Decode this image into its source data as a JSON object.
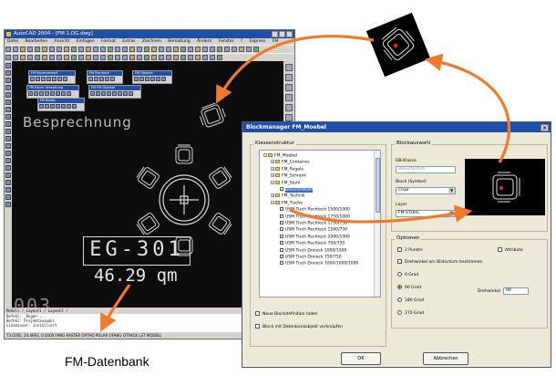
{
  "cad_window": {
    "title": "AutoCAD 2004 - [FM 1.DG.dwg]",
    "menu": [
      "Datei",
      "Bearbeiten",
      "Ansicht",
      "Einfügen",
      "Format",
      "Extras",
      "Zeichnen",
      "Bemaßung",
      "Ändern",
      "Fenster",
      "?",
      "Express",
      "FM"
    ],
    "floating_toolbars": [
      "FM Raumverwalt",
      "FM Planbuch",
      "FM Objekte",
      "FM Raum Verwaltung",
      "FM FM-Objekte",
      "FM Bearb"
    ],
    "room_label": "Besprechnung",
    "room_number": "EG-301",
    "room_area": "46.29 qm",
    "partial_number": "003",
    "cmd_tabs": "Modell / Layout1 / Layout2 /",
    "cmd_lines": [
      "Befehl: _Regen ...",
      "Befehl: Projektauswahl",
      "Lizenzuser: installiert"
    ],
    "status": "73.0165, 14.4692, 0.0000     FANG  RASTER  ORTHO  POLAR  OFANG  OTRACK  LST  MODELL"
  },
  "dialog": {
    "title": "Blockmanager FM_Moebel",
    "close_glyph": "×",
    "left_group_label": "Klassenstruktur",
    "tree": [
      {
        "label": "FM_Moebel",
        "level": 0,
        "type": "folder",
        "expander": "−"
      },
      {
        "label": "FM_Container",
        "level": 1,
        "type": "folder",
        "expander": "+"
      },
      {
        "label": "FM_Regale",
        "level": 1,
        "type": "folder",
        "expander": "+"
      },
      {
        "label": "FM_Schrank",
        "level": 1,
        "type": "folder",
        "expander": "+"
      },
      {
        "label": "FM_Stuhl",
        "level": 1,
        "type": "folder",
        "expander": "−"
      },
      {
        "label": "Besuchsstuhl",
        "level": 2,
        "type": "block",
        "selected": true
      },
      {
        "label": "FM_Technik",
        "level": 1,
        "type": "folder",
        "expander": "+"
      },
      {
        "label": "FM_Tische",
        "level": 1,
        "type": "folder",
        "expander": "−"
      },
      {
        "label": "USM Tisch Rechteck 1500/1000",
        "level": 2,
        "type": "block"
      },
      {
        "label": "USM Tisch Rechteck 1750/1000",
        "level": 2,
        "type": "block"
      },
      {
        "label": "USM Tisch Rechteck 1750/750",
        "level": 2,
        "type": "block"
      },
      {
        "label": "USM Tisch Rechteck 1500/750",
        "level": 2,
        "type": "block"
      },
      {
        "label": "USM Tisch Rechteck 2000/1000",
        "level": 2,
        "type": "block"
      },
      {
        "label": "USM Tisch Rechteck 750/750",
        "level": 2,
        "type": "block"
      },
      {
        "label": "USM Tisch Dreieck 1000/1000",
        "level": 2,
        "type": "block"
      },
      {
        "label": "USM Tisch Dreieck 750/750",
        "level": 2,
        "type": "block"
      },
      {
        "label": "USM Tisch Dreieck 1000/1000/1000",
        "level": 2,
        "type": "block"
      }
    ],
    "check_new_block": "Neue Blockdefinition laden",
    "check_link_db": "Block mit Datenbankobjekt verknüpfen",
    "right_group_label": "Blockauswahl",
    "db_class_label": "DB-Klasse",
    "db_class_value": "Besuchsstuhl",
    "block_symbol_label": "Block (Symbol)",
    "block_symbol_value": "Chair",
    "layer_label": "Layer",
    "layer_value": "FM-STUHL",
    "options_group_label": "Optionen",
    "opt_2points": "2 Punkte",
    "opt_rotate_screen": "Drehwinkel am Bildschirm bestimmen",
    "opt_attributes": "Attribute",
    "angles": [
      "0 Grad",
      "90 Grad",
      "180 Grad",
      "270 Grad"
    ],
    "angle_selected": "90 Grad",
    "rotation_label": "Drehwinkel",
    "rotation_value": "90",
    "ok_label": "OK",
    "cancel_label": "Abbrechen"
  },
  "caption": "FM-Datenbank",
  "colors": {
    "arrow": "#f07a2a",
    "titlebar": "#1f4fa8",
    "cad_bg": "#0d0d0d",
    "dialog_bg": "#ece9d8",
    "selection": "#316ac5"
  },
  "icons": [
    "chair-icon",
    "table-icon",
    "arrow-icon",
    "folder-icon",
    "block-icon"
  ]
}
